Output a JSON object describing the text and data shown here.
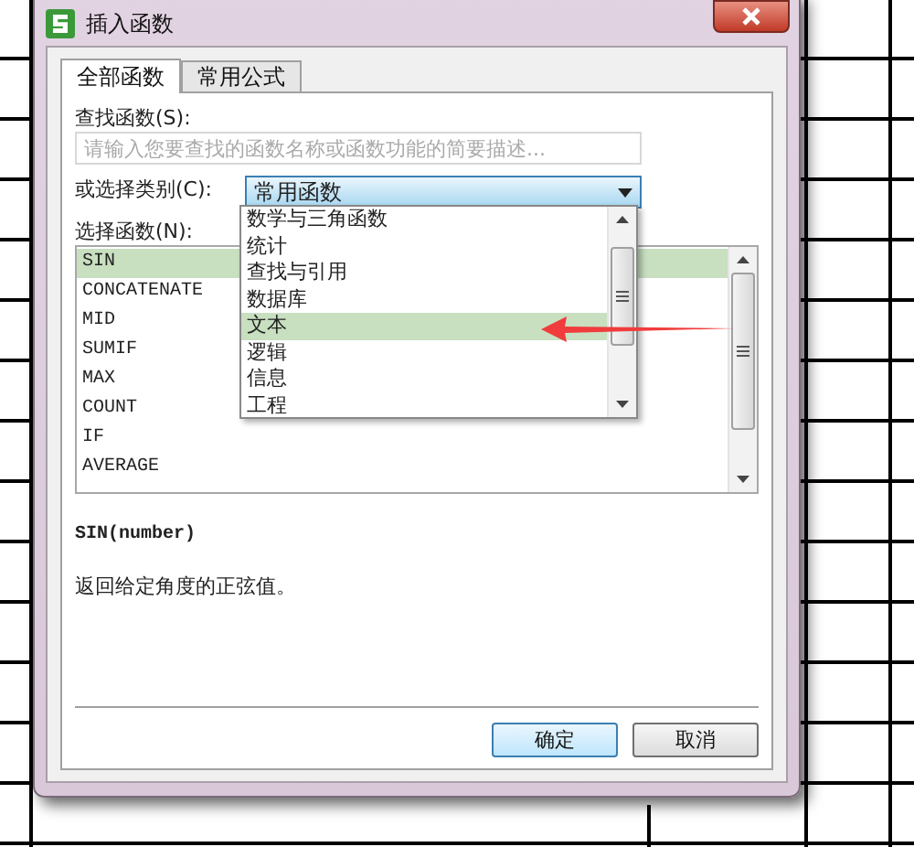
{
  "window": {
    "title": "插入函数"
  },
  "tabs": [
    {
      "label": "全部函数",
      "selected": true
    },
    {
      "label": "常用公式",
      "selected": false
    }
  ],
  "search": {
    "label": "查找函数(S):",
    "placeholder": "请输入您要查找的函数名称或函数功能的简要描述..."
  },
  "category": {
    "label": "或选择类别(C):",
    "value": "常用函数",
    "expanded": true,
    "options": [
      {
        "label": "数学与三角函数",
        "selected": false
      },
      {
        "label": "统计",
        "selected": false
      },
      {
        "label": "查找与引用",
        "selected": false
      },
      {
        "label": "数据库",
        "selected": false
      },
      {
        "label": "文本",
        "selected": true
      },
      {
        "label": "逻辑",
        "selected": false
      },
      {
        "label": "信息",
        "selected": false
      },
      {
        "label": "工程",
        "selected": false
      }
    ]
  },
  "function_list": {
    "label": "选择函数(N):",
    "items": [
      {
        "name": "SIN",
        "selected": true
      },
      {
        "name": "CONCATENATE",
        "selected": false
      },
      {
        "name": "MID",
        "selected": false
      },
      {
        "name": "SUMIF",
        "selected": false
      },
      {
        "name": "MAX",
        "selected": false
      },
      {
        "name": "COUNT",
        "selected": false
      },
      {
        "name": "IF",
        "selected": false
      },
      {
        "name": "AVERAGE",
        "selected": false
      }
    ]
  },
  "syntax": "SIN(number)",
  "description": "返回给定角度的正弦值。",
  "buttons": [
    {
      "label": "确定",
      "default": true
    },
    {
      "label": "取消",
      "default": false
    }
  ]
}
